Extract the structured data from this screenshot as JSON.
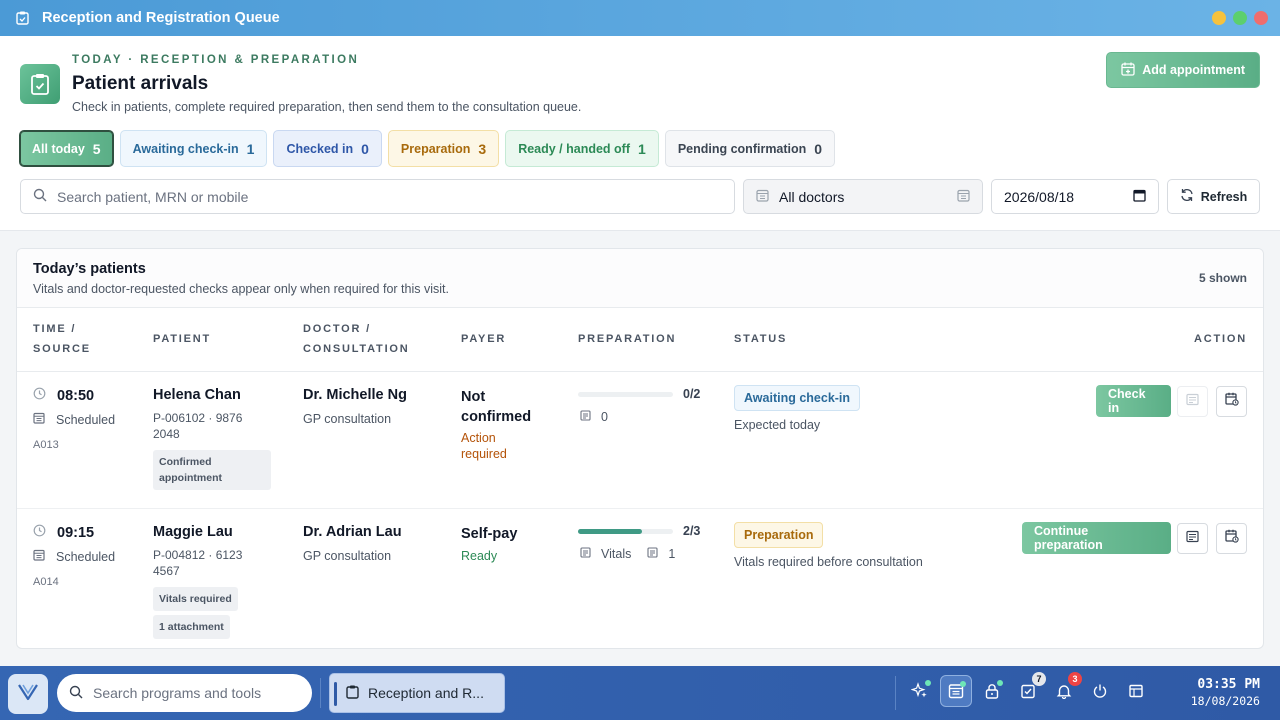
{
  "window": {
    "title": "Reception and Registration Queue"
  },
  "header": {
    "eyebrow": "TODAY · RECEPTION & PREPARATION",
    "title": "Patient arrivals",
    "subtitle": "Check in patients, complete required preparation, then send them to the consultation queue.",
    "add_button": "Add appointment"
  },
  "filters": [
    {
      "label": "All today",
      "count": "5"
    },
    {
      "label": "Awaiting check-in",
      "count": "1"
    },
    {
      "label": "Checked in",
      "count": "0"
    },
    {
      "label": "Preparation",
      "count": "3"
    },
    {
      "label": "Ready / handed off",
      "count": "1"
    },
    {
      "label": "Pending confirmation",
      "count": "0"
    }
  ],
  "search": {
    "placeholder": "Search patient, MRN or mobile"
  },
  "doctor_select": {
    "value": "All doctors"
  },
  "date": {
    "value": "2026/08/18"
  },
  "refresh_label": "Refresh",
  "table": {
    "title": "Today’s patients",
    "subtitle": "Vitals and doctor-requested checks appear only when required for this visit.",
    "shown": "5 shown",
    "columns": {
      "time_1": "TIME /",
      "time_2": "SOURCE",
      "patient": "PATIENT",
      "doctor_1": "DOCTOR /",
      "doctor_2": "CONSULTATION",
      "payer": "PAYER",
      "prep": "PREPARATION",
      "status": "STATUS",
      "action": "ACTION"
    },
    "rows": [
      {
        "time": "08:50",
        "source": "Scheduled",
        "code": "A013",
        "name": "Helena Chan",
        "pid_1": "P-006102 · 9876",
        "pid_2": "2048",
        "tag_1": "Confirmed",
        "tag_2": "appointment",
        "doctor": "Dr. Michelle Ng",
        "consultation": "GP consultation",
        "payer_1": "Not",
        "payer_2": "confirmed",
        "payer_note_1": "Action",
        "payer_note_2": "required",
        "prep_fraction": "0/2",
        "prep_progress": 0,
        "prep_docs": "0",
        "status": "Awaiting check-in",
        "status_note": "Expected today",
        "action": "Check in"
      },
      {
        "time": "09:15",
        "source": "Scheduled",
        "code": "A014",
        "name": "Maggie Lau",
        "pid_1": "P-004812 · 6123",
        "pid_2": "4567",
        "tag_1": "Vitals required",
        "tag_2": "1 attachment",
        "doctor": "Dr. Adrian Lau",
        "consultation": "GP consultation",
        "payer_1": "Self-pay",
        "payer_note_1": "Ready",
        "prep_fraction": "2/3",
        "prep_progress": 0.67,
        "prep_vitals": "Vitals",
        "prep_docs": "1",
        "status": "Preparation",
        "status_note": "Vitals required before consultation",
        "action": "Continue preparation"
      }
    ]
  },
  "taskbar": {
    "search_placeholder": "Search programs and tools",
    "app_label": "Reception and R...",
    "task_badge": "7",
    "notif_badge": "3",
    "time": "03:35 PM",
    "date": "18/08/2026"
  }
}
